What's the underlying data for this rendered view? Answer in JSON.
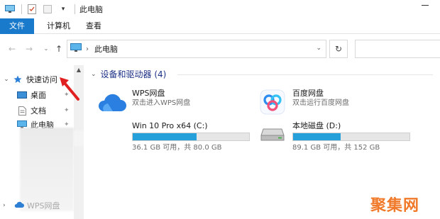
{
  "window": {
    "title": "此电脑"
  },
  "ribbon": {
    "tabs": [
      {
        "label": "文件",
        "active": true
      },
      {
        "label": "计算机"
      },
      {
        "label": "查看"
      }
    ]
  },
  "address": {
    "path": "此电脑"
  },
  "sidebar": {
    "quick_access": "快速访问",
    "items": [
      {
        "label": "桌面",
        "icon": "desktop-icon"
      },
      {
        "label": "文档",
        "icon": "document-icon"
      },
      {
        "label": "此电脑",
        "icon": "computer-icon"
      }
    ],
    "bottom_item": "WPS网盘"
  },
  "main": {
    "group_title": "设备和驱动器 (4)",
    "devices": [
      {
        "name": "WPS网盘",
        "desc": "双击进入WPS网盘",
        "icon": "cloud-icon"
      },
      {
        "name": "百度网盘",
        "desc": "双击运行百度网盘",
        "icon": "baidu-netdisk-icon"
      }
    ],
    "drives": [
      {
        "name": "Win 10 Pro x64 (C:)",
        "free": "36.1 GB 可用，共 80.0 GB",
        "used_fraction": 0.55,
        "icon": "windows-drive-icon"
      },
      {
        "name": "本地磁盘 (D:)",
        "free": "89.1 GB 可用，共 152 GB",
        "used_fraction": 0.41,
        "icon": "hard-drive-icon"
      }
    ]
  },
  "watermark": "聚集网",
  "colors": {
    "accent": "#1979ca",
    "bar_fill": "#26a0da",
    "annotation": "#e02020",
    "watermark": "#f07a2a"
  }
}
